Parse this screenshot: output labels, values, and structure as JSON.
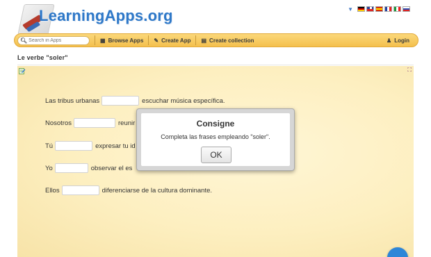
{
  "header": {
    "logo_text": "LearningApps.org",
    "languages": [
      "de-flag-icon",
      "gb-flag-icon",
      "es-flag-icon",
      "fr-flag-icon",
      "it-flag-icon",
      "ru-flag-icon"
    ]
  },
  "navbar": {
    "search_placeholder": "Search in Apps",
    "browse_label": "Browse Apps",
    "create_label": "Create App",
    "collection_label": "Create collection",
    "login_label": "Login"
  },
  "page": {
    "title": "Le verbe \"soler\""
  },
  "exercise": {
    "sentences": [
      {
        "before": "Las tribus urbanas",
        "after": "escuchar música específica.",
        "blank_value": ""
      },
      {
        "before": "Nosotros",
        "after": "reunir",
        "blank_value": ""
      },
      {
        "before": "Tú",
        "after": "expresar tu id",
        "blank_value": ""
      },
      {
        "before": "Yo",
        "after": "observar el es",
        "blank_value": ""
      },
      {
        "before": "Ellos",
        "after": "diferenciarse de la cultura dominante.",
        "blank_value": ""
      }
    ]
  },
  "modal": {
    "title": "Consigne",
    "text": "Completa las frases empleando \"soler\".",
    "ok_label": "OK"
  },
  "colors": {
    "accent": "#2e78c8",
    "navbar": "#f4c04d",
    "exercise_bg": "#fdefc0"
  }
}
